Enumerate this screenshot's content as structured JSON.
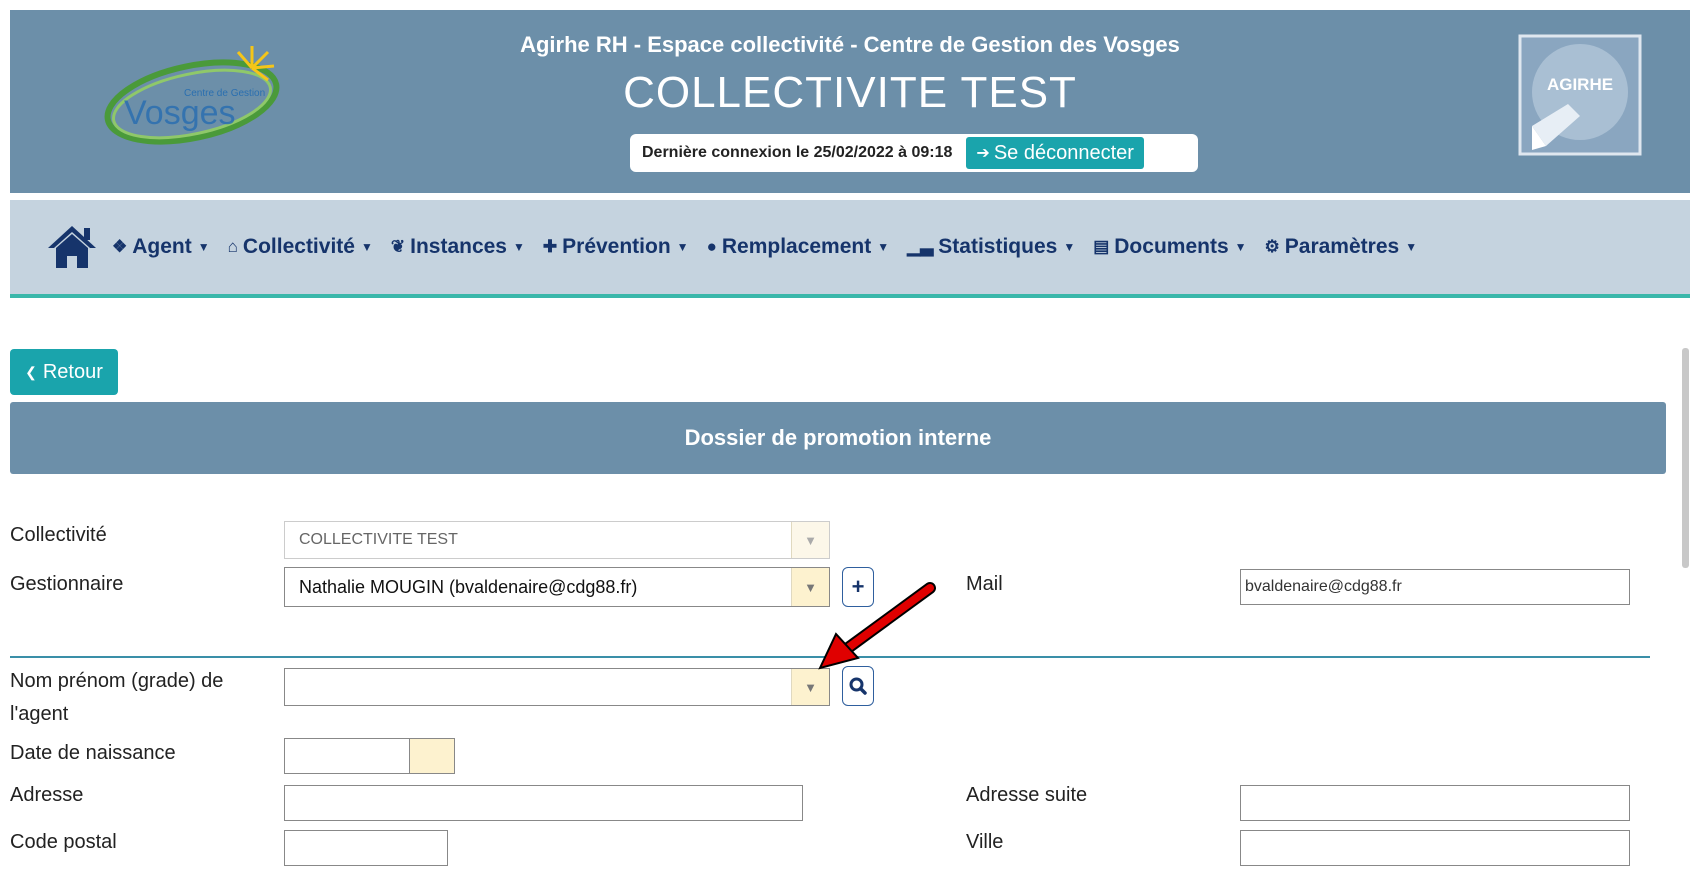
{
  "header": {
    "subtitle": "Agirhe RH - Espace collectivité - Centre de Gestion des Vosges",
    "title": "COLLECTIVITE TEST",
    "last_login": "Dernière connexion le 25/02/2022 à 09:18",
    "logout_label": "Se déconnecter",
    "logo_left_text": "Vosges",
    "logo_left_small": "Centre de Gestion",
    "logo_right_text": "AGIRHE"
  },
  "nav": {
    "items": [
      {
        "label": "Agent",
        "icon": "users-icon"
      },
      {
        "label": "Collectivité",
        "icon": "institution-icon"
      },
      {
        "label": "Instances",
        "icon": "handshake-icon"
      },
      {
        "label": "Prévention",
        "icon": "medkit-icon"
      },
      {
        "label": "Remplacement",
        "icon": "user-clock-icon"
      },
      {
        "label": "Statistiques",
        "icon": "chart-icon"
      },
      {
        "label": "Documents",
        "icon": "file-icon"
      },
      {
        "label": "Paramètres",
        "icon": "cogs-icon"
      }
    ]
  },
  "page": {
    "back_label": "Retour",
    "section_title": "Dossier de promotion interne"
  },
  "form": {
    "collectivite_label": "Collectivité",
    "collectivite_value": "COLLECTIVITE TEST",
    "gestionnaire_label": "Gestionnaire",
    "gestionnaire_value": "Nathalie MOUGIN (bvaldenaire@cdg88.fr)",
    "mail_label": "Mail",
    "mail_value": "bvaldenaire@cdg88.fr",
    "agent_label_1": "Nom prénom (grade) de",
    "agent_label_2": "l'agent",
    "agent_value": "",
    "birth_label": "Date de naissance",
    "birth_value": "",
    "address_label": "Adresse",
    "address_value": "",
    "address2_label": "Adresse suite",
    "address2_value": "",
    "postal_label": "Code postal",
    "postal_value": "",
    "city_label": "Ville",
    "city_value": ""
  },
  "colors": {
    "header_bg": "#6c8fa9",
    "nav_bg": "#c5d3df",
    "accent": "#1aa4ac",
    "nav_text": "#16346b",
    "annotation_arrow": "#e00000"
  }
}
